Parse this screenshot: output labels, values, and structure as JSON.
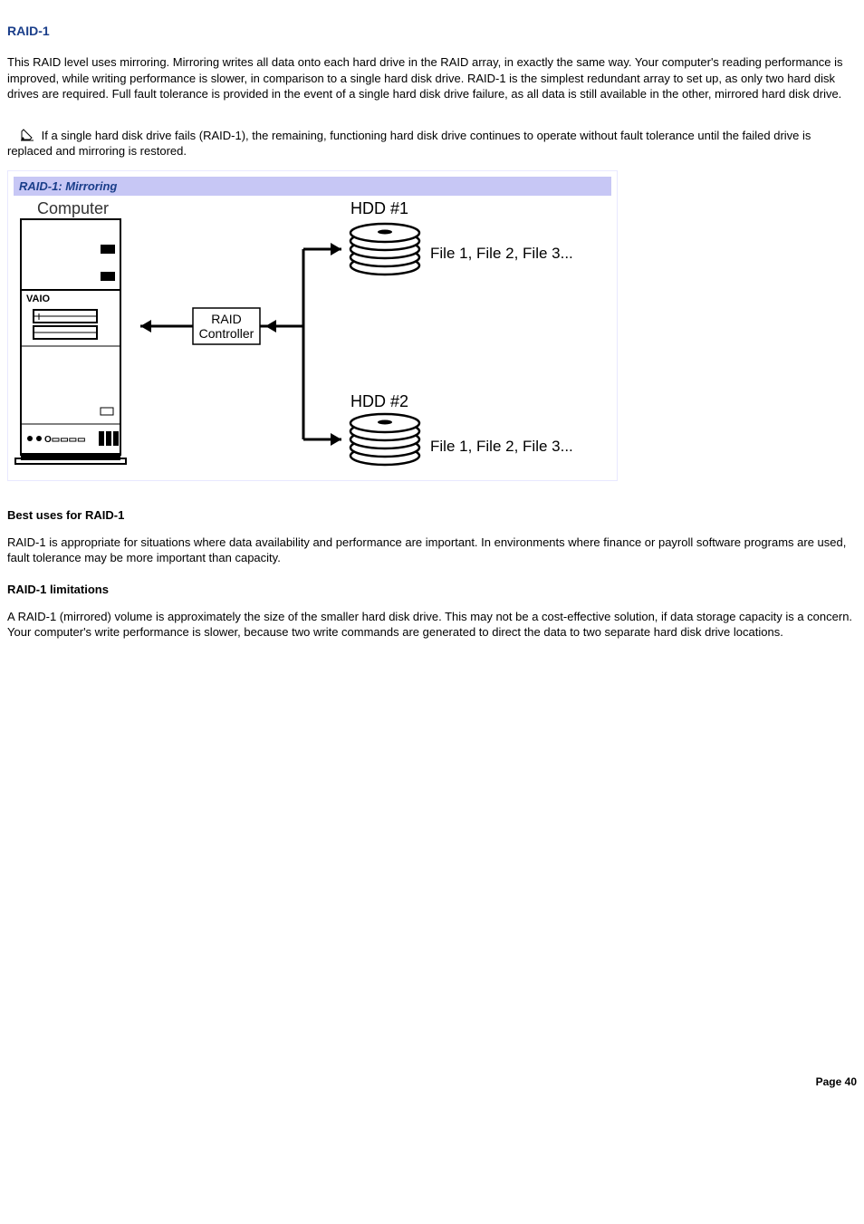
{
  "heading": "RAID-1",
  "intro_paragraph": "This RAID level uses mirroring. Mirroring writes all data onto each hard drive in the RAID array, in exactly the same way. Your computer's reading performance is improved, while writing performance is slower, in comparison to a single hard disk drive. RAID-1 is the simplest redundant array to set up, as only two hard disk drives are required. Full fault tolerance is provided in the event of a single hard disk drive failure, as all data is still available in the other, mirrored hard disk drive.",
  "note_text": "If a single hard disk drive fails (RAID-1), the remaining, functioning hard disk drive continues to operate without fault tolerance until the failed drive is replaced and mirroring is restored.",
  "figure": {
    "title": "RAID-1: Mirroring",
    "labels": {
      "computer": "Computer",
      "raid_controller_line1": "RAID",
      "raid_controller_line2": "Controller",
      "hdd1": "HDD #1",
      "hdd2": "HDD #2",
      "files1": "File 1, File 2, File 3...",
      "files2": "File 1, File 2, File 3..."
    }
  },
  "best_uses": {
    "heading": "Best uses for RAID-1",
    "text": "RAID-1 is appropriate for situations where data availability and performance are important. In environments where finance or payroll software programs are used, fault tolerance may be more important than capacity."
  },
  "limitations": {
    "heading": "RAID-1 limitations",
    "text": "A RAID-1 (mirrored) volume is approximately the size of the smaller hard disk drive. This may not be a cost-effective solution, if data storage capacity is a concern. Your computer's write performance is slower, because two write commands are generated to direct the data to two separate hard disk drive locations."
  },
  "page_label": "Page 40"
}
